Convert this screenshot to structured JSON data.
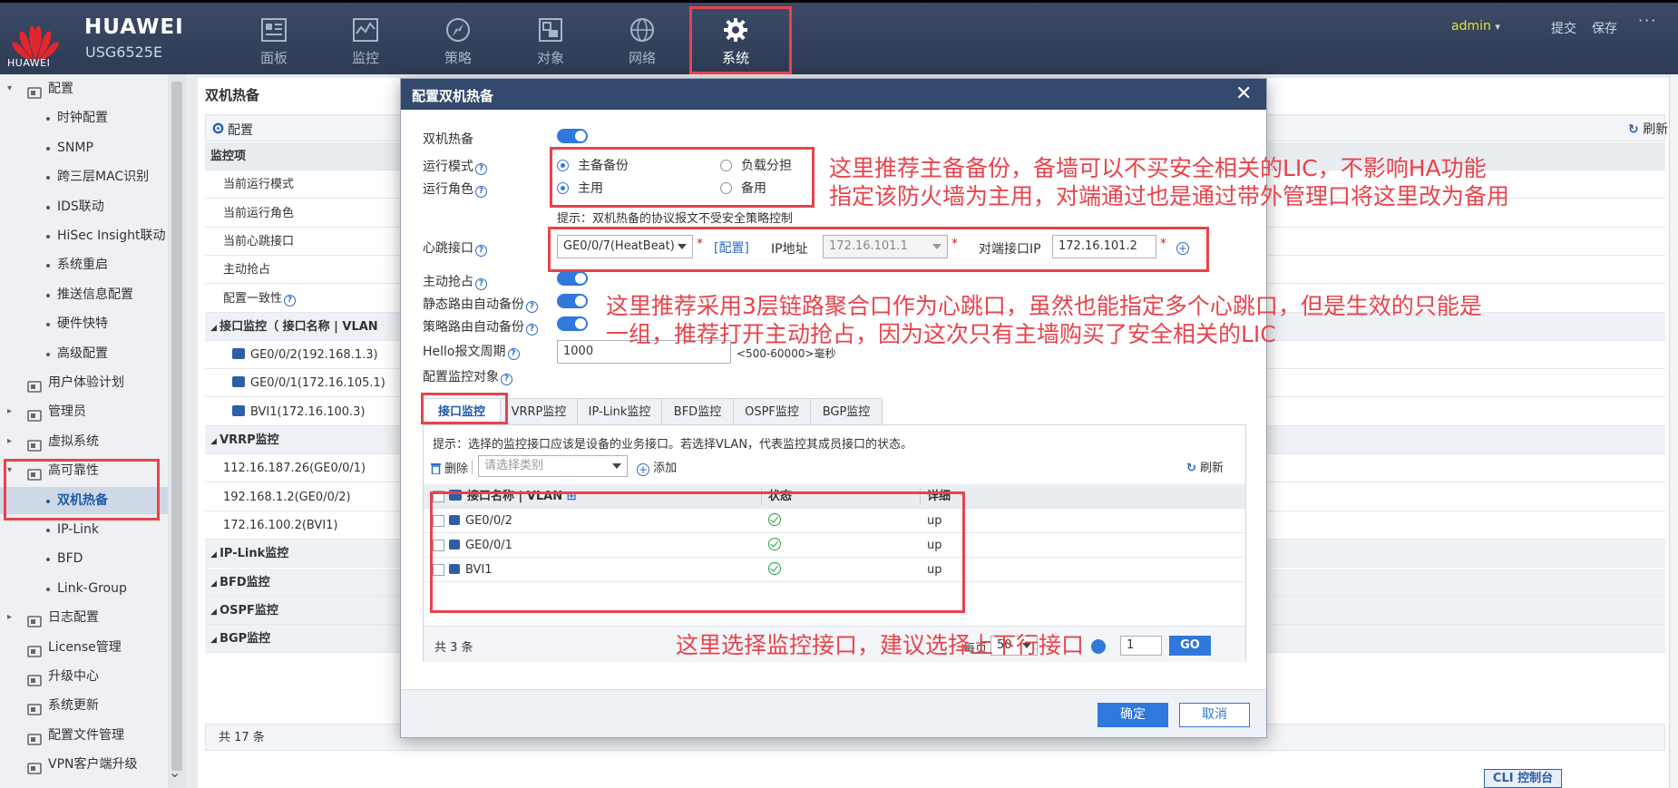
{
  "header": {
    "logo_caption": "HUAWEI",
    "brand": "HUAWEI",
    "model": "USG6525E",
    "nav": [
      "面板",
      "监控",
      "策略",
      "对象",
      "网络",
      "系统"
    ],
    "user": "admin",
    "user_caret": "▾",
    "actions": [
      "提交",
      "保存"
    ],
    "more": "···"
  },
  "sidebar": {
    "items": [
      {
        "label": "配置",
        "type": "group",
        "expand": "▾"
      },
      {
        "label": "时钟配置",
        "type": "sub"
      },
      {
        "label": "SNMP",
        "type": "sub"
      },
      {
        "label": "跨三层MAC识别",
        "type": "sub"
      },
      {
        "label": "IDS联动",
        "type": "sub"
      },
      {
        "label": "HiSec Insight联动",
        "type": "sub"
      },
      {
        "label": "系统重启",
        "type": "sub"
      },
      {
        "label": "推送信息配置",
        "type": "sub"
      },
      {
        "label": "硬件快特",
        "type": "sub"
      },
      {
        "label": "高级配置",
        "type": "sub"
      },
      {
        "label": "用户体验计划",
        "type": "leaf"
      },
      {
        "label": "管理员",
        "type": "group",
        "expand": "▸"
      },
      {
        "label": "虚拟系统",
        "type": "group",
        "expand": "▸"
      },
      {
        "label": "高可靠性",
        "type": "group",
        "expand": "▾"
      },
      {
        "label": "双机热备",
        "type": "sub",
        "selected": true
      },
      {
        "label": "IP-Link",
        "type": "sub"
      },
      {
        "label": "BFD",
        "type": "sub"
      },
      {
        "label": "Link-Group",
        "type": "sub"
      },
      {
        "label": "日志配置",
        "type": "group",
        "expand": "▸"
      },
      {
        "label": "License管理",
        "type": "leaf"
      },
      {
        "label": "升级中心",
        "type": "leaf"
      },
      {
        "label": "系统更新",
        "type": "leaf"
      },
      {
        "label": "配置文件管理",
        "type": "leaf"
      },
      {
        "label": "VPN客户端升级",
        "type": "leaf"
      }
    ],
    "scroll_down": "⌄"
  },
  "main": {
    "title": "双机热备",
    "config_label": "配置",
    "refresh_label": "刷新",
    "rows": [
      {
        "label": "监控项",
        "kind": "head"
      },
      {
        "label": "当前运行模式",
        "kind": "row"
      },
      {
        "label": "当前运行角色",
        "kind": "row"
      },
      {
        "label": "当前心跳接口",
        "kind": "row"
      },
      {
        "label": "主动抢占",
        "kind": "row"
      },
      {
        "label": "配置一致性",
        "kind": "row"
      },
      {
        "label": "接口监控（ 接口名称 | VLAN",
        "kind": "sect"
      },
      {
        "label": "GE0/0/2(192.168.1.3)",
        "kind": "if"
      },
      {
        "label": "GE0/0/1(172.16.105.1)",
        "kind": "if"
      },
      {
        "label": "BVI1(172.16.100.3)",
        "kind": "if"
      },
      {
        "label": "VRRP监控",
        "kind": "sect"
      },
      {
        "label": "112.16.187.26(GE0/0/1)",
        "kind": "row"
      },
      {
        "label": "192.168.1.2(GE0/0/2)",
        "kind": "row"
      },
      {
        "label": "172.16.100.2(BVI1)",
        "kind": "row"
      },
      {
        "label": "IP-Link监控",
        "kind": "sect"
      },
      {
        "label": "BFD监控",
        "kind": "sect"
      },
      {
        "label": "OSPF监控",
        "kind": "sect"
      },
      {
        "label": "BGP监控",
        "kind": "sect"
      }
    ],
    "total": "共 17 条",
    "cli": "CLI 控制台"
  },
  "dialog": {
    "title": "配置双机热备",
    "close": "✕",
    "labels": {
      "ha": "双机热备",
      "mode": "运行模式",
      "role": "运行角色",
      "heartbeat": "心跳接口",
      "preempt": "主动抢占",
      "static_route": "静态路由自动备份",
      "policy_route": "策略路由自动备份",
      "hello": "Hello报文周期",
      "monitor": "配置监控对象"
    },
    "mode_options": [
      "主备备份",
      "负载分担"
    ],
    "role_options": [
      "主用",
      "备用"
    ],
    "hint": "提示：双机热备的协议报文不受安全策略控制",
    "heartbeat_if": "GE0/0/7(HeatBeat)",
    "config_link": "[配置]",
    "ip_label": "IP地址",
    "ip_value": "172.16.101.1",
    "peer_label": "对端接口IP",
    "peer_value": "172.16.101.2",
    "required_mark": "*",
    "hello_value": "1000",
    "hello_unit": "<500-60000>毫秒",
    "tabs": [
      "接口监控",
      "VRRP监控",
      "IP-Link监控",
      "BFD监控",
      "OSPF监控",
      "BGP监控"
    ],
    "tab_hint": "提示：选择的监控接口应该是设备的业务接口。若选择VLAN，代表监控其成员接口的状态。",
    "toolbar": {
      "delete": "删除",
      "category_placeholder": "请选择类别",
      "add": "添加",
      "refresh": "刷新"
    },
    "table": {
      "columns": [
        "接口名称 | VLAN",
        "状态",
        "详细"
      ],
      "rows": [
        {
          "name": "GE0/0/2",
          "detail": "up"
        },
        {
          "name": "GE0/0/1",
          "detail": "up"
        },
        {
          "name": "BVI1",
          "detail": "up"
        }
      ]
    },
    "pager": {
      "total": "共 3 条",
      "size_prefix": "每页",
      "size": "50",
      "page": "1",
      "go": "GO"
    },
    "ok": "确定",
    "cancel": "取消"
  },
  "annotations": {
    "note1_line1": "这里推荐主备备份，备墙可以不买安全相关的LIC，不影响HA功能",
    "note1_line2": "指定该防火墙为主用，对端通过也是通过带外管理口将这里改为备用",
    "note2_line1": "这里推荐采用3层链路聚合口作为心跳口，虽然也能指定多个心跳口，但是生效的只能是",
    "note2_line2": "一组，推荐打开主动抢占，因为这次只有主墙购买了安全相关的LIC",
    "note3": "这里选择监控接口，建议选择上下行接口",
    "color": "#e8434b"
  }
}
